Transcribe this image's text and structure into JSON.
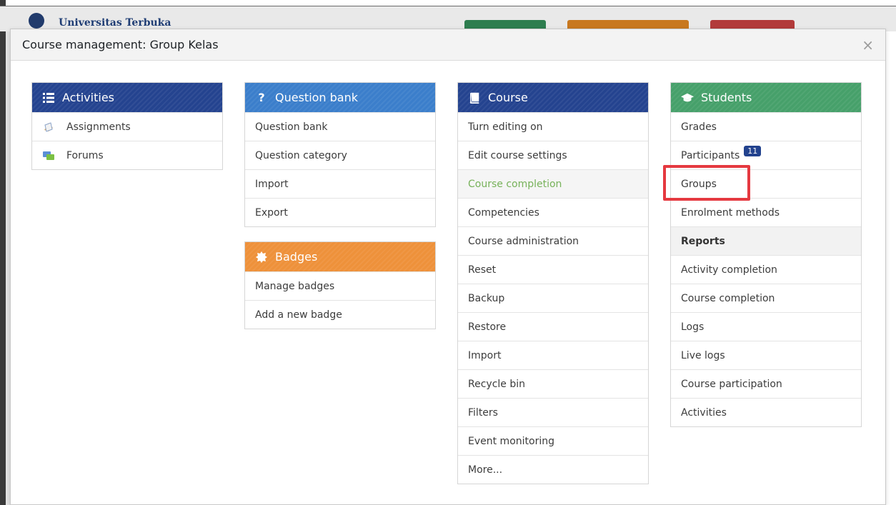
{
  "background": {
    "brand": "Universitas Terbuka"
  },
  "modal": {
    "title": "Course management: Group Kelas",
    "close": "×"
  },
  "activities": {
    "title": "Activities",
    "items": [
      "Assignments",
      "Forums"
    ]
  },
  "question_bank": {
    "title": "Question bank",
    "items": [
      "Question bank",
      "Question category",
      "Import",
      "Export"
    ]
  },
  "badges": {
    "title": "Badges",
    "items": [
      "Manage badges",
      "Add a new badge"
    ]
  },
  "course": {
    "title": "Course",
    "items": [
      "Turn editing on",
      "Edit course settings",
      "Course completion",
      "Competencies",
      "Course administration",
      "Reset",
      "Backup",
      "Restore",
      "Import",
      "Recycle bin",
      "Filters",
      "Event monitoring",
      "More..."
    ],
    "active_index": 2
  },
  "students": {
    "title": "Students",
    "items": [
      "Grades",
      "Participants",
      "Groups",
      "Enrolment methods"
    ],
    "participants_count": "11",
    "reports_heading": "Reports",
    "report_items": [
      "Activity completion",
      "Course completion",
      "Logs",
      "Live logs",
      "Course participation",
      "Activities"
    ]
  },
  "colors": {
    "activities": "#24438f",
    "question_bank": "#3b7ecb",
    "course": "#24438f",
    "students": "#46a06a",
    "badges": "#ee913a",
    "highlight": "#e53940",
    "active_link": "#77b25a"
  },
  "icons": {
    "activities": "list-icon",
    "question_bank": "question-icon",
    "course": "book-icon",
    "students": "graduation-cap-icon",
    "badges": "badge-star-icon",
    "assignments": "assignment-icon",
    "forums": "forum-icon",
    "close": "close-icon"
  }
}
